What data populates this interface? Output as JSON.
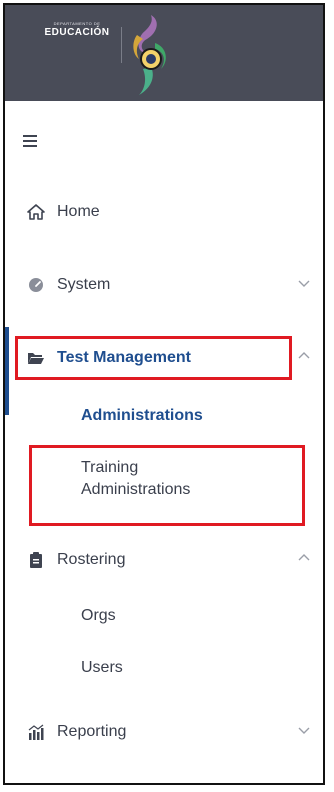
{
  "brand": {
    "small_text": "DEPARTAMENTO DE",
    "main_text": "EDUCACIÓN",
    "header_color": "#494c58"
  },
  "colors": {
    "accent": "#1f4e8f",
    "highlight_box": "#e01a22",
    "text": "#3a3f4c"
  },
  "sidebar": {
    "menu_icon": "hamburger-icon",
    "items": [
      {
        "label": "Home",
        "icon": "home-icon"
      },
      {
        "label": "System",
        "icon": "gauge-icon",
        "chevron": "chevron-down"
      },
      {
        "label": "Test Management",
        "icon": "folder-open-icon",
        "chevron": "chevron-up",
        "active": true,
        "children": [
          {
            "label": "Administrations",
            "active": true
          },
          {
            "label": "Training\nAdministrations"
          }
        ]
      },
      {
        "label": "Rostering",
        "icon": "clipboard-icon",
        "chevron": "chevron-up",
        "children": [
          {
            "label": "Orgs"
          },
          {
            "label": "Users"
          }
        ]
      },
      {
        "label": "Reporting",
        "icon": "bar-chart-icon",
        "chevron": "chevron-down"
      }
    ]
  }
}
